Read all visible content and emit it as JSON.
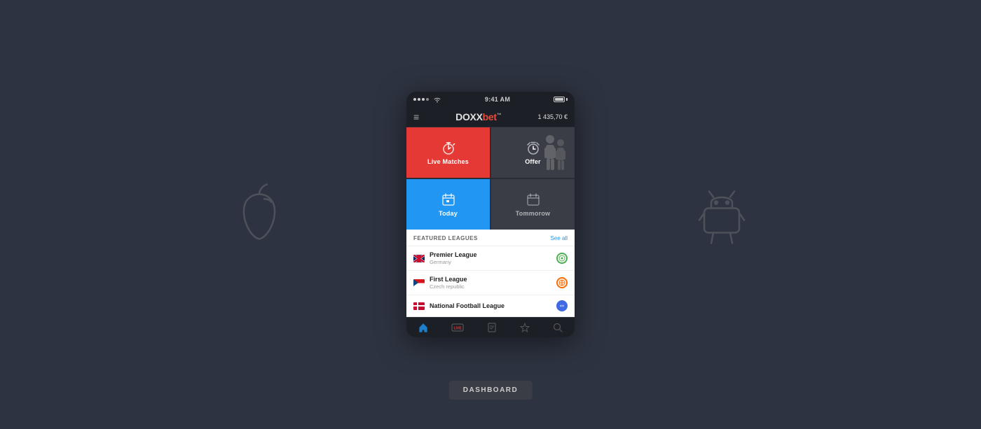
{
  "background": "#2d3340",
  "statusBar": {
    "time": "9:41 AM",
    "dots": [
      true,
      true,
      true,
      false
    ]
  },
  "header": {
    "logoDoxx": "DOXX",
    "logoBet": "bet",
    "logoTm": "™",
    "balance": "1 435,70 €",
    "menuIcon": "≡"
  },
  "tiles": [
    {
      "id": "live-matches",
      "label": "Live Matches",
      "icon": "stopwatch",
      "color": "red"
    },
    {
      "id": "offer",
      "label": "Offer",
      "icon": "alarm",
      "color": "dark"
    },
    {
      "id": "today",
      "label": "Today",
      "icon": "calendar",
      "color": "blue"
    },
    {
      "id": "tomorrow",
      "label": "Tommorow",
      "icon": "calendar-outline",
      "color": "dark"
    }
  ],
  "featuredLeagues": {
    "title": "FEATURED LEAGUES",
    "seeAll": "See all",
    "items": [
      {
        "name": "Premier League",
        "country": "Germany",
        "flag": "uk",
        "sport": "soccer"
      },
      {
        "name": "First League",
        "country": "Czech republic",
        "flag": "cz",
        "sport": "basketball"
      },
      {
        "name": "National Football League",
        "country": "",
        "flag": "dk",
        "sport": "football"
      }
    ]
  },
  "bottomNav": [
    {
      "icon": "home",
      "label": ""
    },
    {
      "icon": "live",
      "label": "LIVE"
    },
    {
      "icon": "checklist",
      "label": ""
    },
    {
      "icon": "star",
      "label": ""
    },
    {
      "icon": "search",
      "label": ""
    }
  ],
  "dashboardButton": "DASHBOARD",
  "appleLogoLabel": "Apple",
  "androidLogoLabel": "Android"
}
